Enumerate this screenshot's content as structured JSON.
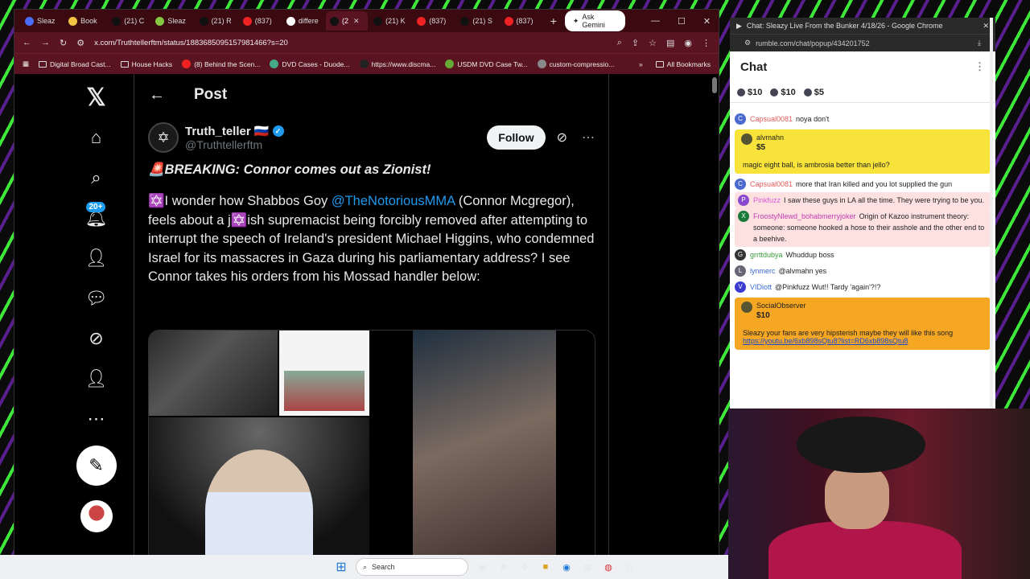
{
  "browser": {
    "tabs": [
      {
        "label": "Sleaz",
        "icon": "rumble-icon",
        "color": "#4b6cf7"
      },
      {
        "label": "Book",
        "icon": "star-icon",
        "color": "#f4c542"
      },
      {
        "label": "(21) C",
        "icon": "x-icon",
        "color": "#111"
      },
      {
        "label": "Sleaz",
        "icon": "rumble-icon",
        "color": "#85c742"
      },
      {
        "label": "(21) R",
        "icon": "x-icon",
        "color": "#111"
      },
      {
        "label": "(837)",
        "icon": "youtube-icon",
        "color": "#e22"
      },
      {
        "label": "differe",
        "icon": "google-icon",
        "color": "#fff"
      },
      {
        "label": "(2",
        "icon": "x-icon",
        "color": "#111"
      },
      {
        "label": "(21) K",
        "icon": "x-icon",
        "color": "#111"
      },
      {
        "label": "(837)",
        "icon": "youtube-icon",
        "color": "#e22"
      },
      {
        "label": "(21) S",
        "icon": "x-icon",
        "color": "#111"
      },
      {
        "label": "(837)",
        "icon": "youtube-icon",
        "color": "#e22"
      }
    ],
    "gemini": "Ask Gemini",
    "url": "x.com/Truthtellerftm/status/1883685095157981466?s=20",
    "bookmarks": [
      "Digital Broad Cast...",
      "House Hacks",
      "(8) Behind the Scen...",
      "DVD Cases - Duode...",
      "https://www.discma...",
      "USDM DVD Case Tw...",
      "custom-compressio..."
    ],
    "all_bookmarks": "All Bookmarks"
  },
  "x": {
    "badge": "20+",
    "header_title": "Post",
    "author_name": "Truth_teller 🇷🇺",
    "author_handle": "@Truthtellerftm",
    "follow_label": "Follow",
    "headline": "🚨BREAKING: Connor comes out as Zionist!",
    "body_1": "✡️I wonder how Shabbos Goy ",
    "mention": "@TheNotoriousMMA",
    "body_2": " (Connor Mcgregor), feels about a j✡️ish supremacist being forcibly removed after attempting to interrupt the speech of Ireland's president Michael Higgins, who condemned Israel for its massacres in Gaza during his parliamentary address? I see Connor takes his orders from his Mossad handler below:"
  },
  "chat": {
    "window_title": "Chat: Sleazy Live From the Bunker 4/18/26 - Google Chrome",
    "url": "rumble.com/chat/popup/434201752",
    "title": "Chat",
    "tips": [
      "$10",
      "$10",
      "$5"
    ],
    "messages": [
      {
        "user": "Capsual0081",
        "text": "noya don't",
        "color": "#e05a5a",
        "initial": "C",
        "avatar_color": "#4a6ad0"
      },
      {
        "rant": true,
        "style": "y",
        "user": "alvmahn",
        "amount": "$5",
        "text": "magic eight ball, is ambrosia better than jello?"
      },
      {
        "user": "Capsual0081",
        "text": "more that Iran killed and you lot supplied the gun",
        "color": "#e05a5a",
        "initial": "C",
        "avatar_color": "#4a6ad0"
      },
      {
        "user": "Pinkfuzz",
        "text": "I saw these guys in LA all the time. They were trying to be you.",
        "color": "#d65bd6",
        "initial": "P",
        "avatar_color": "#8a4ad0",
        "highlight": true
      },
      {
        "user": "FroostyNlewd_bohabmerryjoker",
        "text": "Origin of Kazoo instrument theory: someone: someone hooked a hose to their asshole and the other end to a beehive.",
        "color": "#c23bb0",
        "initial": "X",
        "avatar_color": "#1a7a3a",
        "highlight": true
      },
      {
        "user": "grrttdubya",
        "text": "Whuddup boss",
        "color": "#3a9a3a",
        "initial": "G",
        "avatar_color": "#333"
      },
      {
        "user": "lynmerc",
        "text": "@alvmahn yes",
        "color": "#3a6ad0",
        "initial": "L",
        "avatar_color": "#667"
      },
      {
        "user": "VIDiott",
        "text": "@Pinkfuzz Wut!! Tardy 'again'?!?",
        "color": "#3a6ad0",
        "initial": "V",
        "avatar_color": "#3a3ad0"
      },
      {
        "rant": true,
        "style": "o",
        "user": "SocialObserver",
        "amount": "$10",
        "text": "Sleazy your fans are very hipsterish maybe they will like this song",
        "link": "https://youtu.be/6xb898sQtu8?list=RD6xb898sQtu8"
      }
    ]
  },
  "taskbar": {
    "search": "Search"
  }
}
